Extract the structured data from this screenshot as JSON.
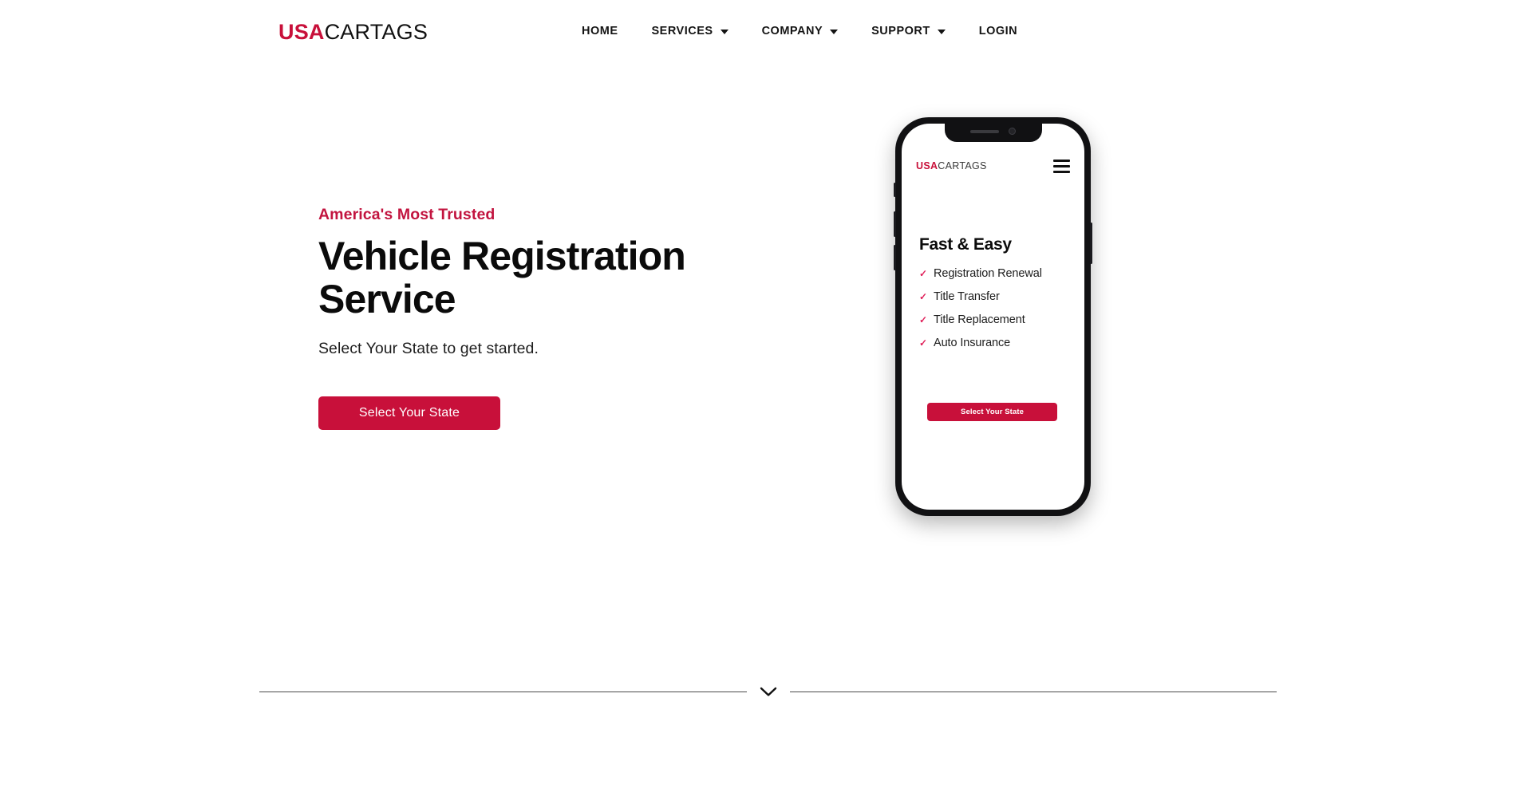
{
  "brand": {
    "prefix": "USA",
    "suffix": "CARTAGS"
  },
  "colors": {
    "accent": "#c8103a",
    "eyebrow": "#c2143f",
    "check": "#e0215a",
    "text": "#0b0b0b",
    "divider": "#4a4a4a",
    "phone_frame": "#111113"
  },
  "nav": {
    "items": [
      {
        "label": "HOME",
        "has_dropdown": false
      },
      {
        "label": "SERVICES",
        "has_dropdown": true
      },
      {
        "label": "COMPANY",
        "has_dropdown": true
      },
      {
        "label": "SUPPORT",
        "has_dropdown": true
      },
      {
        "label": "LOGIN",
        "has_dropdown": false
      }
    ]
  },
  "hero": {
    "eyebrow": "America's Most Trusted",
    "headline": "Vehicle Registration Service",
    "subline": "Select Your State to get started.",
    "cta_label": "Select Your State"
  },
  "phone": {
    "brand_prefix": "USA",
    "brand_suffix": "CARTAGS",
    "menu_icon": "hamburger-icon",
    "title": "Fast & Easy",
    "check_glyph": "✓",
    "features": [
      {
        "label": "Registration Renewal"
      },
      {
        "label": "Title Transfer"
      },
      {
        "label": "Title Replacement"
      },
      {
        "label": "Auto Insurance"
      }
    ],
    "cta_label": "Select Your State"
  },
  "footer": {
    "scroll_icon": "chevron-down-icon"
  }
}
